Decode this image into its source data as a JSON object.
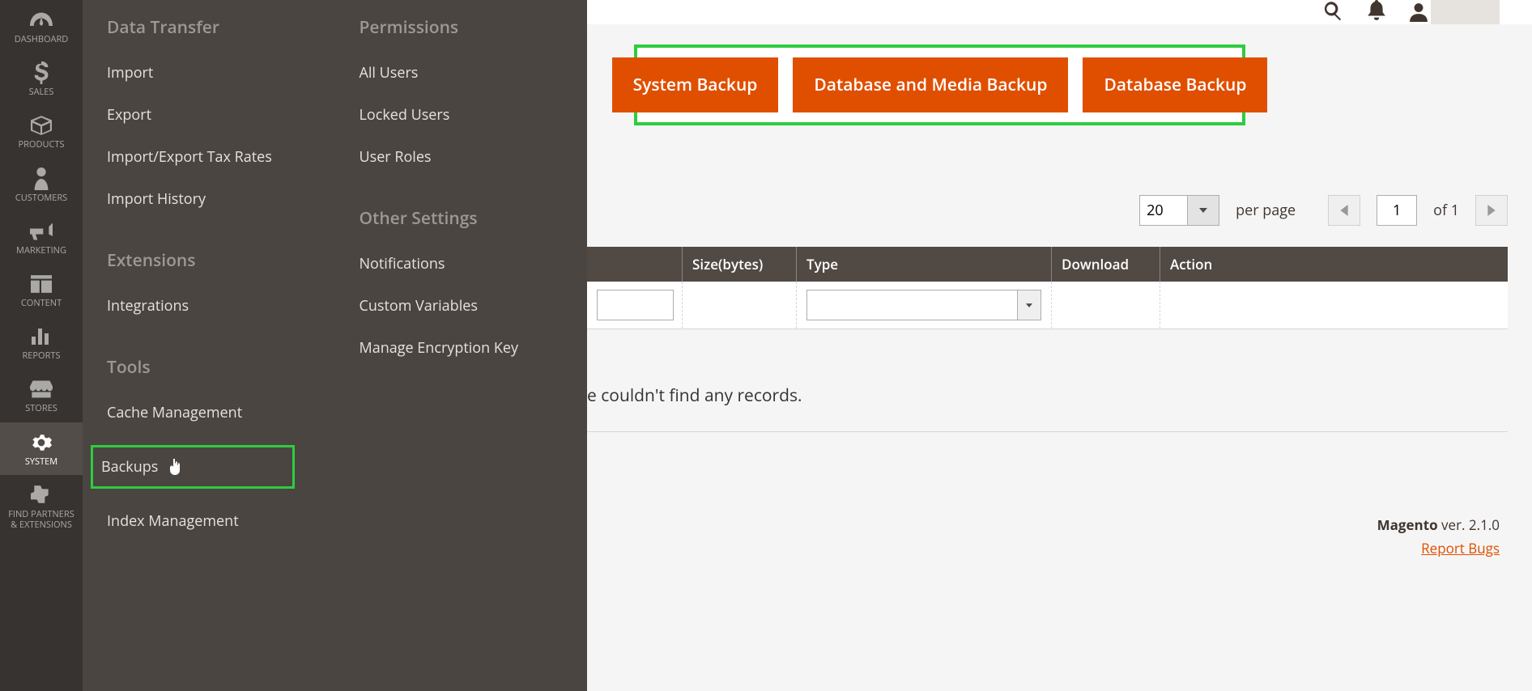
{
  "sidebar": {
    "items": [
      {
        "label": "DASHBOARD"
      },
      {
        "label": "SALES"
      },
      {
        "label": "PRODUCTS"
      },
      {
        "label": "CUSTOMERS"
      },
      {
        "label": "MARKETING"
      },
      {
        "label": "CONTENT"
      },
      {
        "label": "REPORTS"
      },
      {
        "label": "STORES"
      },
      {
        "label": "SYSTEM"
      },
      {
        "label": "FIND PARTNERS\n& EXTENSIONS"
      }
    ]
  },
  "flyout": {
    "col1": {
      "section1_title": "Data Transfer",
      "section1_items": [
        "Import",
        "Export",
        "Import/Export Tax Rates",
        "Import History"
      ],
      "section2_title": "Extensions",
      "section2_items": [
        "Integrations"
      ],
      "section3_title": "Tools",
      "section3_items": [
        "Cache Management",
        "Backups",
        "Index Management"
      ]
    },
    "col2": {
      "section1_title": "Permissions",
      "section1_items": [
        "All Users",
        "Locked Users",
        "User Roles"
      ],
      "section2_title": "Other Settings",
      "section2_items": [
        "Notifications",
        "Custom Variables",
        "Manage Encryption Key"
      ]
    }
  },
  "buttons": {
    "system_backup": "System Backup",
    "db_media_backup": "Database and Media Backup",
    "db_backup": "Database Backup"
  },
  "pagination": {
    "page_size": "20",
    "per_page_label": "per page",
    "current_page": "1",
    "of_label": "of 1"
  },
  "table": {
    "headers": {
      "size": "Size(bytes)",
      "type": "Type",
      "download": "Download",
      "action": "Action"
    }
  },
  "no_records": "e couldn't find any records.",
  "footer": {
    "brand": "Magento",
    "version": " ver. 2.1.0",
    "report_bugs": "Report Bugs"
  }
}
